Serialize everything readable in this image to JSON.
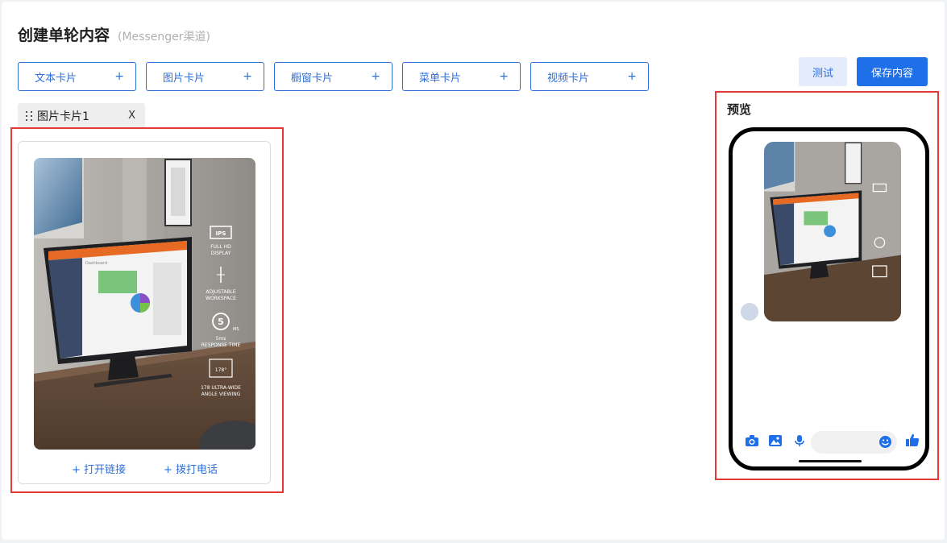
{
  "header": {
    "title": "创建单轮内容",
    "subtitle": "(Messenger渠道)"
  },
  "card_buttons": [
    {
      "label": "文本卡片",
      "plus": "+"
    },
    {
      "label": "图片卡片",
      "plus": "+"
    },
    {
      "label": "橱窗卡片",
      "plus": "+"
    },
    {
      "label": "菜单卡片",
      "plus": "+"
    },
    {
      "label": "视频卡片",
      "plus": "+"
    }
  ],
  "actions": {
    "test_label": "测试",
    "save_label": "保存内容"
  },
  "tab": {
    "label": "图片卡片1",
    "close": "X"
  },
  "editor": {
    "links": [
      {
        "label": "+ 打开链接"
      },
      {
        "label": "+ 拨打电话"
      }
    ],
    "image_text": {
      "ips": "IPS",
      "full_hd": "FULL HD",
      "display": "DISPLAY",
      "adjustable": "ADJUSTABLE",
      "workspace": "WORKSPACE",
      "five": "5",
      "ms": "MS",
      "five_ms": "5ms",
      "response_time": "RESPONSE TIME",
      "angle": "178°",
      "ultra_wide": "178 ULTRA-WIDE",
      "angle_viewing": "ANGLE VIEWING",
      "dashboard": "Dashboard"
    }
  },
  "preview": {
    "label": "预览"
  },
  "icons": {
    "camera": "camera-icon",
    "image": "image-icon",
    "mic": "microphone-icon",
    "emoji": "emoji-icon",
    "like": "thumbs-up-icon"
  },
  "colors": {
    "accent": "#1e6fe8",
    "border_blue": "#2f6fd8",
    "highlight_red": "#e53935"
  }
}
